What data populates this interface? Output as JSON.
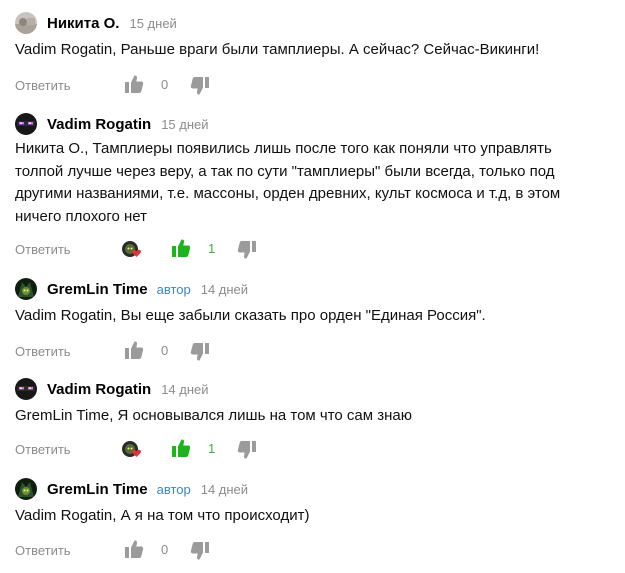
{
  "colors": {
    "like_active": "#1db31d",
    "icon_gray": "#9b9b9b",
    "author_tag": "#3b87c5",
    "meta_gray": "#8c8c8c"
  },
  "comments": [
    {
      "author": "Никита О.",
      "date": "15 дней",
      "text": "Vadim Rogatin, Раньше враги были тамплиеры. А сейчас? Сейчас-Викинги!",
      "reply_label": "Ответить",
      "likes": "0",
      "liked": false
    },
    {
      "author": "Vadim Rogatin",
      "date": "15 дней",
      "text": "Никита О., Тамплиеры появились лишь после того как поняли что управлять толпой лучше через веру, а так по сути \"тамплиеры\" были всегда, только под другими названиями, т.е. массоны, орден древних, культ космоса и т.д, в этом ничего плохого нет",
      "reply_label": "Ответить",
      "likes": "1",
      "liked": true
    },
    {
      "author": "GremLin Time",
      "author_tag": "автор",
      "date": "14 дней",
      "text": "Vadim Rogatin, Вы еще забыли сказать про орден \"Единая Россия\".",
      "reply_label": "Ответить",
      "likes": "0",
      "liked": false
    },
    {
      "author": "Vadim Rogatin",
      "date": "14 дней",
      "text": "GremLin Time, Я основывался лишь на том что сам знаю",
      "reply_label": "Ответить",
      "likes": "1",
      "liked": true
    },
    {
      "author": "GremLin Time",
      "author_tag": "автор",
      "date": "14 дней",
      "text": "Vadim Rogatin, А я на том что происходит)",
      "reply_label": "Ответить",
      "likes": "0",
      "liked": false
    }
  ]
}
